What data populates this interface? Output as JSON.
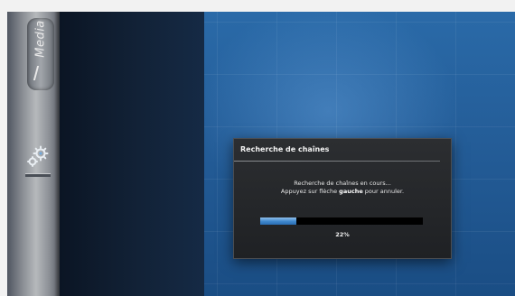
{
  "sidebar": {
    "media_tab_label": "Media",
    "items": [
      {
        "icon": "gear-icon"
      }
    ]
  },
  "dialog": {
    "title": "Recherche de chaînes",
    "message_line1": "Recherche de chaînes en cours...",
    "message_line2_prefix": "Appuyez sur flèche ",
    "message_line2_bold": "gauche",
    "message_line2_suffix": " pour annuler.",
    "progress_percent": 22,
    "progress_label": "22%"
  },
  "colors": {
    "background_blue": "#1d4f86",
    "progress_fill": "#3e86cc",
    "dialog_bg": "#2c2e31"
  }
}
